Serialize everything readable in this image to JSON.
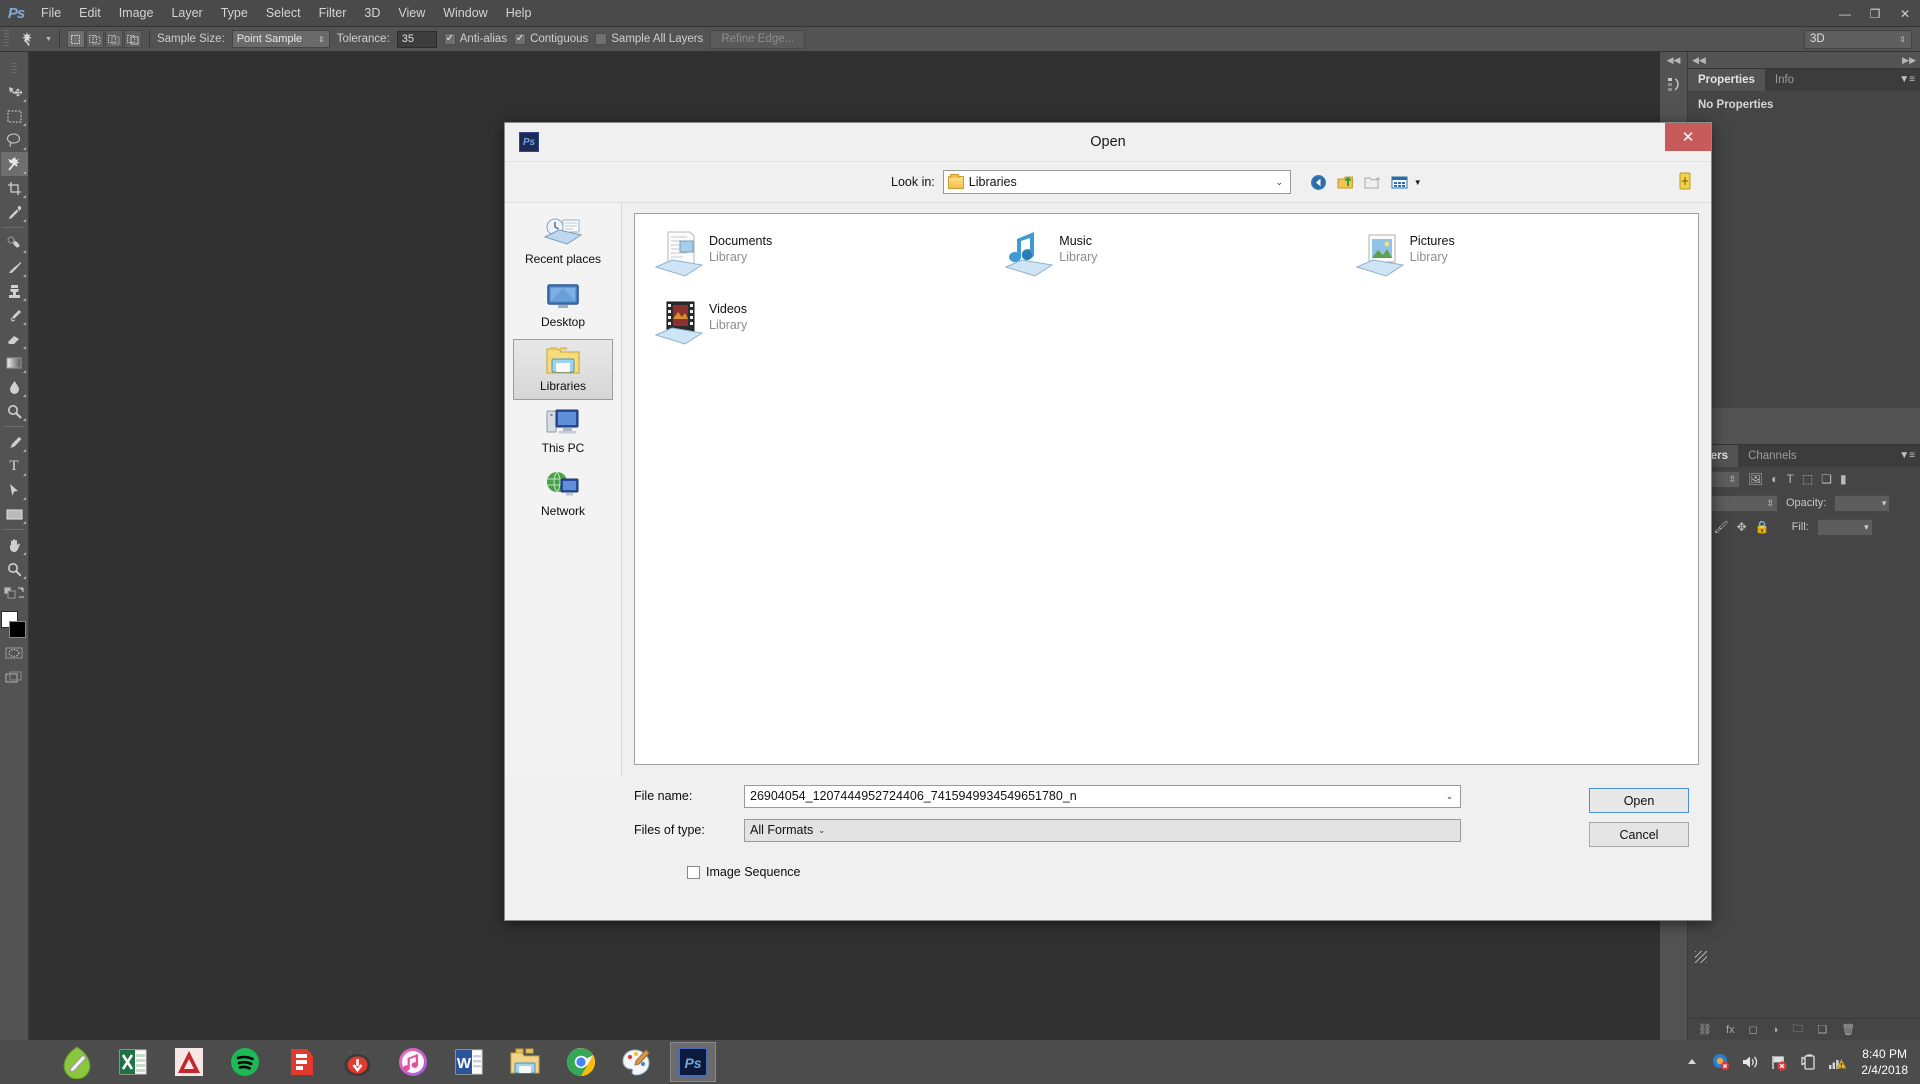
{
  "app": {
    "name": "Adobe Photoshop",
    "logo_text": "Ps",
    "menus": [
      "File",
      "Edit",
      "Image",
      "Layer",
      "Type",
      "Select",
      "Filter",
      "3D",
      "View",
      "Window",
      "Help"
    ],
    "window_buttons": {
      "minimize": "—",
      "restore": "❐",
      "close": "✕"
    }
  },
  "options_bar": {
    "sample_size_label": "Sample Size:",
    "sample_size_value": "Point Sample",
    "tolerance_label": "Tolerance:",
    "tolerance_value": "35",
    "anti_alias_label": "Anti-alias",
    "anti_alias_checked": "✓",
    "contiguous_label": "Contiguous",
    "contiguous_checked": "✓",
    "sample_all_layers_label": "Sample All Layers",
    "sample_all_layers_checked": "",
    "refine_edge_label": "Refine Edge...",
    "workspace_value": "3D",
    "mode_buttons": [
      "new-selection",
      "add-to-selection",
      "subtract-from-selection",
      "intersect-selection"
    ]
  },
  "toolbar": {
    "tools": [
      {
        "name": "move-tool",
        "glyph": "✥"
      },
      {
        "name": "rectangular-marquee-tool",
        "glyph": "⬚"
      },
      {
        "name": "lasso-tool",
        "glyph": "⬭"
      },
      {
        "name": "magic-wand-tool",
        "glyph": "✸",
        "active": true
      },
      {
        "name": "crop-tool",
        "glyph": "⛶"
      },
      {
        "name": "eyedropper-tool",
        "glyph": "✐"
      },
      {
        "name": "spot-healing-brush-tool",
        "glyph": "⚗"
      },
      {
        "name": "brush-tool",
        "glyph": "✎"
      },
      {
        "name": "clone-stamp-tool",
        "glyph": "⚓"
      },
      {
        "name": "history-brush-tool",
        "glyph": "✒"
      },
      {
        "name": "eraser-tool",
        "glyph": "▱"
      },
      {
        "name": "gradient-tool",
        "glyph": "▤"
      },
      {
        "name": "blur-tool",
        "glyph": "●"
      },
      {
        "name": "dodge-tool",
        "glyph": "⚲"
      },
      {
        "name": "pen-tool",
        "glyph": "✒"
      },
      {
        "name": "type-tool",
        "glyph": "T"
      },
      {
        "name": "path-selection-tool",
        "glyph": "➤"
      },
      {
        "name": "rectangle-tool",
        "glyph": "▬"
      },
      {
        "name": "hand-tool",
        "glyph": "✋"
      },
      {
        "name": "zoom-tool",
        "glyph": "⚲"
      }
    ],
    "quick_mask_label": "",
    "screen_mode_label": ""
  },
  "right_dock": {
    "properties_panel": {
      "tabs": [
        "Properties",
        "Info"
      ],
      "active_tab": "Properties",
      "empty_text": "No Properties"
    },
    "layers_panel": {
      "tabs": [
        "ayers",
        "Channels"
      ],
      "active_tab": "ayers",
      "opacity_label": "Opacity:",
      "fill_label": "Fill:"
    }
  },
  "open_dialog": {
    "title": "Open",
    "app_icon_text": "Ps",
    "close_label": "✕",
    "look_in_label": "Look in:",
    "look_in_value": "Libraries",
    "nav_icons": [
      "back-icon",
      "up-one-level-icon",
      "create-new-folder-icon",
      "views-icon"
    ],
    "places": [
      {
        "name": "recent-places",
        "label": "Recent places",
        "selected": false
      },
      {
        "name": "desktop",
        "label": "Desktop",
        "selected": false
      },
      {
        "name": "libraries",
        "label": "Libraries",
        "selected": true
      },
      {
        "name": "this-pc",
        "label": "This PC",
        "selected": false
      },
      {
        "name": "network",
        "label": "Network",
        "selected": false
      }
    ],
    "items": [
      {
        "name": "Documents",
        "subtitle": "Library",
        "icon": "documents-library-icon"
      },
      {
        "name": "Music",
        "subtitle": "Library",
        "icon": "music-library-icon"
      },
      {
        "name": "Pictures",
        "subtitle": "Library",
        "icon": "pictures-library-icon"
      },
      {
        "name": "Videos",
        "subtitle": "Library",
        "icon": "videos-library-icon"
      }
    ],
    "file_name_label": "File name:",
    "file_name_value": "26904054_1207444952724406_7415949934549651780_n",
    "files_of_type_label": "Files of type:",
    "files_of_type_value": "All Formats",
    "image_sequence_label": "Image Sequence",
    "image_sequence_checked": false,
    "open_button": "Open",
    "cancel_button": "Cancel"
  },
  "taskbar": {
    "apps": [
      {
        "name": "coreldraw",
        "label": "CorelDRAW",
        "active": false
      },
      {
        "name": "excel",
        "label": "Excel",
        "active": false
      },
      {
        "name": "autocad",
        "label": "AutoCAD",
        "active": false
      },
      {
        "name": "spotify",
        "label": "Spotify",
        "active": false
      },
      {
        "name": "sketchup",
        "label": "SketchUp",
        "active": false
      },
      {
        "name": "downloader",
        "label": "Downloader",
        "active": false
      },
      {
        "name": "itunes",
        "label": "iTunes",
        "active": false
      },
      {
        "name": "word",
        "label": "Word",
        "active": false
      },
      {
        "name": "file-explorer",
        "label": "File Explorer",
        "active": false
      },
      {
        "name": "chrome",
        "label": "Google Chrome",
        "active": false
      },
      {
        "name": "paint",
        "label": "Paint",
        "active": false
      },
      {
        "name": "photoshop",
        "label": "Adobe Photoshop",
        "active": true
      }
    ],
    "tray": [
      "show-hidden-icons",
      "antivirus-icon",
      "volume-icon",
      "action-center-icon",
      "battery-icon",
      "network-icon"
    ],
    "clock_time": "8:40 PM",
    "clock_date": "2/4/2018"
  },
  "colors": {
    "ps_chrome": "#535353",
    "ps_canvas": "#313131",
    "dialog_bg": "#f0f0f0",
    "close_red": "#c75b5b",
    "focus_blue": "#4a90d9",
    "taskbar": "#4c4c4c"
  }
}
